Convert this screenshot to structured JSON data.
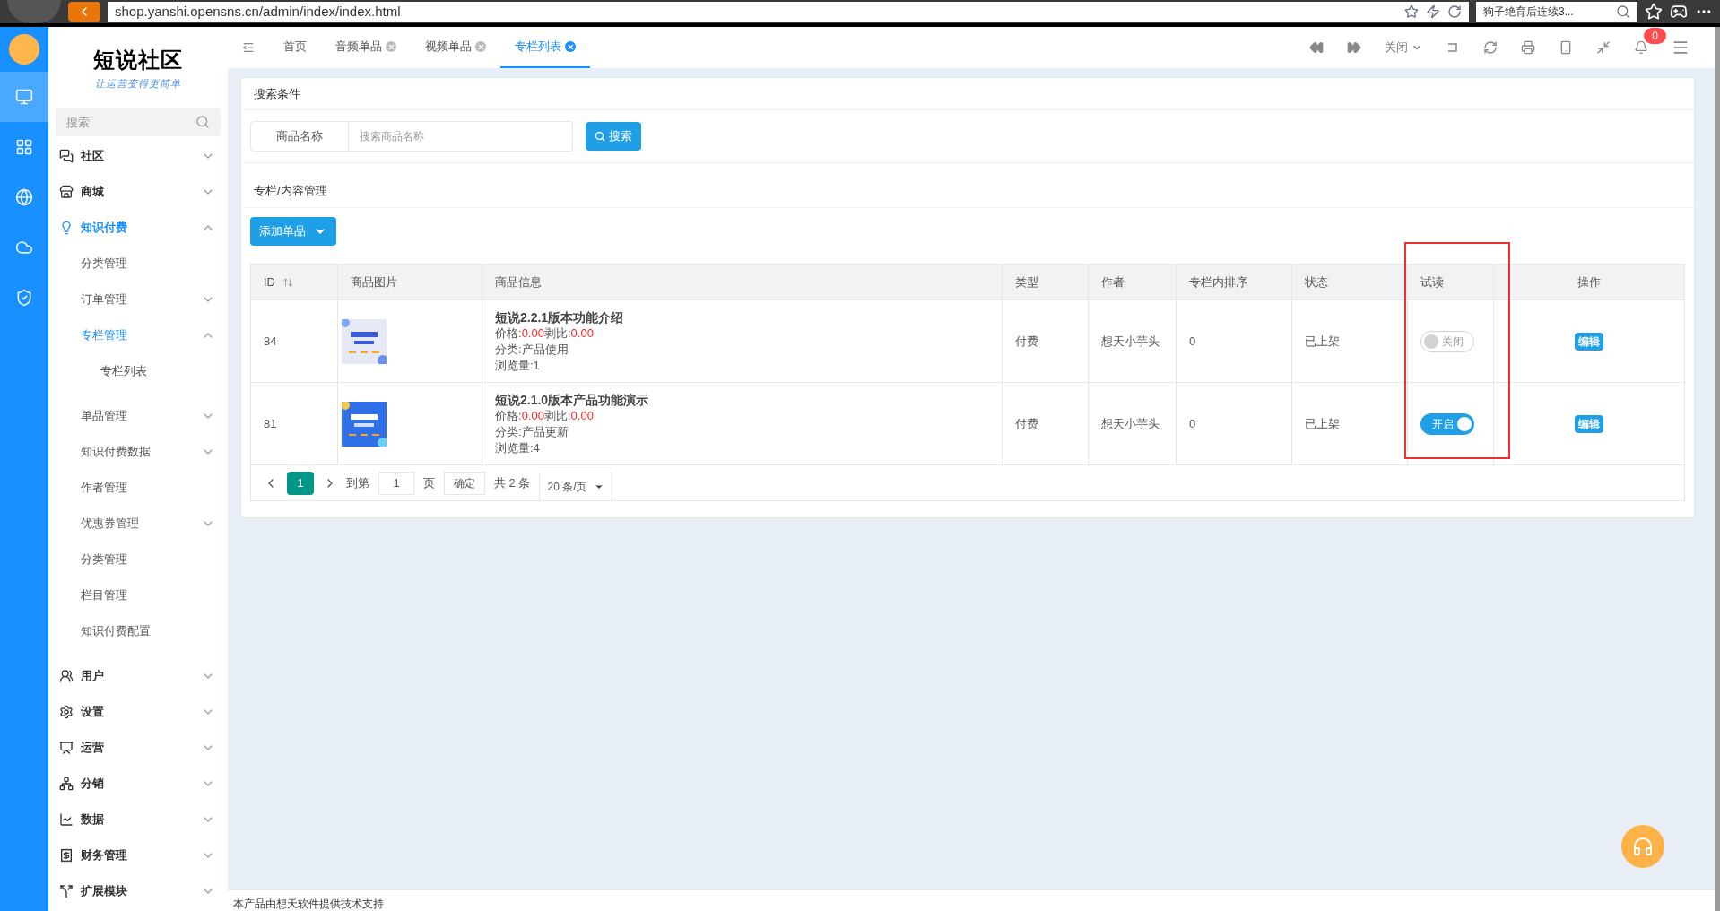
{
  "browser": {
    "url": "shop.yanshi.opensns.cn/admin/index/index.html",
    "search_text": "狗子绝育后连续3..."
  },
  "logo": {
    "title": "短说社区",
    "slogan": "让运营变得更简单"
  },
  "rail": [
    {
      "selected": true
    },
    {
      "selected": false
    },
    {
      "selected": false
    },
    {
      "selected": false
    },
    {
      "selected": false
    }
  ],
  "sidebar": {
    "search": {
      "placeholder": "搜索"
    },
    "items": [
      {
        "label": "社区",
        "expanded": false,
        "selected": false
      },
      {
        "label": "商城",
        "expanded": false,
        "selected": false
      },
      {
        "label": "知识付费",
        "expanded": true,
        "selected": true,
        "children": [
          {
            "label": "分类管理",
            "selected": false
          },
          {
            "label": "订单管理",
            "expanded": false,
            "selected": false
          },
          {
            "label": "专栏管理",
            "expanded": true,
            "selected": true,
            "children": [
              {
                "label": "专栏列表",
                "selected": false
              }
            ]
          },
          {
            "label": "单品管理",
            "expanded": false,
            "selected": false
          },
          {
            "label": "知识付费数据",
            "expanded": false,
            "selected": false
          },
          {
            "label": "作者管理",
            "selected": false
          },
          {
            "label": "优惠券管理",
            "expanded": false,
            "selected": false
          },
          {
            "label": "分类管理",
            "selected": false
          },
          {
            "label": "栏目管理",
            "selected": false
          },
          {
            "label": "知识付费配置",
            "selected": false
          }
        ]
      },
      {
        "label": "用户",
        "expanded": false,
        "selected": false
      },
      {
        "label": "设置",
        "expanded": false,
        "selected": false
      },
      {
        "label": "运营",
        "expanded": false,
        "selected": false
      },
      {
        "label": "分销",
        "expanded": false,
        "selected": false
      },
      {
        "label": "数据",
        "expanded": false,
        "selected": false
      },
      {
        "label": "财务管理",
        "expanded": false,
        "selected": false
      },
      {
        "label": "扩展模块",
        "expanded": false,
        "selected": false
      }
    ]
  },
  "tabs": [
    {
      "label": "首页",
      "closable": false,
      "selected": false
    },
    {
      "label": "音频单品",
      "closable": true,
      "selected": false
    },
    {
      "label": "视频单品",
      "closable": true,
      "selected": false
    },
    {
      "label": "专栏列表",
      "closable": true,
      "selected": true
    }
  ],
  "header": {
    "close_menu": "关闭",
    "notifications": "0"
  },
  "search_panel": {
    "title": "搜索条件",
    "field_label": "商品名称",
    "placeholder": "搜索商品名称",
    "button": "搜索"
  },
  "content": {
    "title": "专栏/内容管理",
    "add_button": "添加单品"
  },
  "table": {
    "columns": [
      "ID",
      "商品图片",
      "商品信息",
      "类型",
      "作者",
      "专栏内排序",
      "状态",
      "试读",
      "操作"
    ],
    "rows": [
      {
        "id": "84",
        "title": "短说2.2.1版本功能介绍",
        "price_label": "价格:",
        "price": "0.00",
        "ratio_label": "剥比:",
        "ratio": "0.00",
        "category": "分类:产品使用",
        "views": "浏览量:1",
        "type": "付费",
        "author": "想天小芋头",
        "order": "0",
        "status": "已上架",
        "trial": {
          "on": false,
          "label": "关闭"
        },
        "action": "编辑"
      },
      {
        "id": "81",
        "title": "短说2.1.0版本产品功能演示",
        "price_label": "价格:",
        "price": "0.00",
        "ratio_label": "剥比:",
        "ratio": "0.00",
        "category": "分类:产品更新",
        "views": "浏览量:4",
        "type": "付费",
        "author": "想天小芋头",
        "order": "0",
        "status": "已上架",
        "trial": {
          "on": true,
          "label": "开启"
        },
        "action": "编辑"
      }
    ]
  },
  "pagination": {
    "pages": [
      {
        "label": "1",
        "selected": true
      }
    ],
    "goto_label": "到第",
    "goto_value": "1",
    "page_unit": "页",
    "confirm": "确定",
    "total": "共 2 条",
    "page_size": "20 条/页"
  },
  "footer": {
    "text": "本产品由想天软件提供技术支持"
  }
}
